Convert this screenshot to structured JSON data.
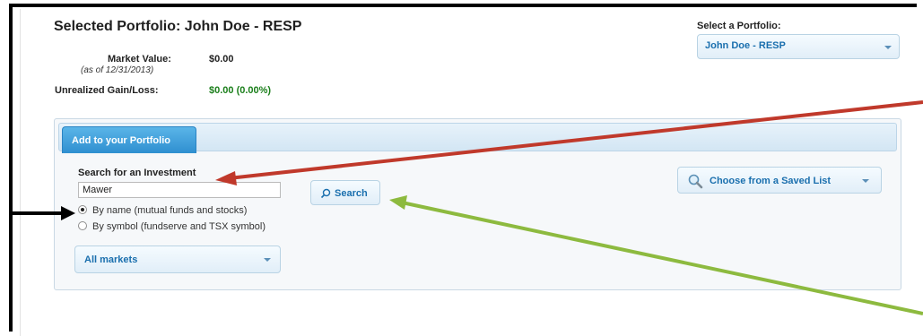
{
  "header": {
    "title": "Selected Portfolio: John Doe - RESP",
    "market_value_label": "Market Value:",
    "market_value_date": "(as of 12/31/2013)",
    "market_value": "$0.00",
    "gain_loss_label": "Unrealized Gain/Loss:",
    "gain_loss_value": "$0.00 (0.00%)"
  },
  "portfolio_selector": {
    "label": "Select a Portfolio:",
    "selected": "John Doe - RESP"
  },
  "panel": {
    "tab_label": "Add to your Portfolio",
    "search_label": "Search for an Investment",
    "search_value": "Mawer",
    "search_button_label": "Search",
    "radio_options": [
      {
        "label": "By name (mutual funds and stocks)",
        "checked": true
      },
      {
        "label": "By symbol (fundserve and TSX symbol)",
        "checked": false
      }
    ],
    "markets_selected": "All markets",
    "saved_list_label": "Choose from a Saved List"
  },
  "icons": {
    "search": "search-icon",
    "magnifier": "magnifier-icon",
    "dropdown": "chevron-down-icon"
  },
  "colors": {
    "accent": "#1a6fae",
    "tab": "#3a9ad8",
    "gain": "#1b7f1b",
    "annotation_red": "#c0392b",
    "annotation_green": "#8dba3f",
    "annotation_black": "#000000"
  }
}
